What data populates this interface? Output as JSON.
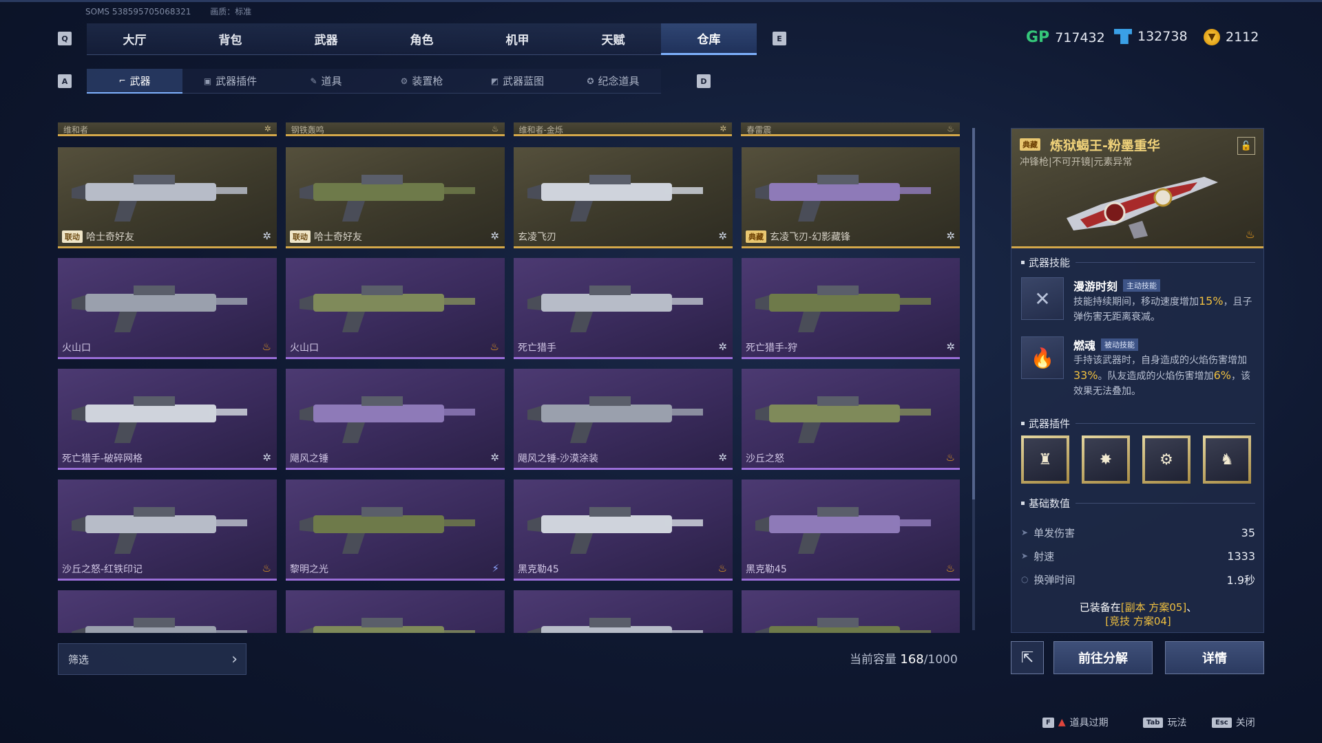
{
  "meta": {
    "server": "SOMS 538595705068321",
    "quality": "画质：标准"
  },
  "keys": {
    "prev_main": "Q",
    "next_main": "E",
    "prev_sub": "A",
    "next_sub": "D"
  },
  "main_tabs": [
    "大厅",
    "背包",
    "武器",
    "角色",
    "机甲",
    "天赋",
    "仓库"
  ],
  "main_active": "仓库",
  "currency": {
    "gp_label": "GP",
    "gp": "717432",
    "ticket": "132738",
    "coin": "2112"
  },
  "sub_tabs": [
    {
      "label": "武器",
      "icon": "gun-icon"
    },
    {
      "label": "武器插件",
      "icon": "chip-icon"
    },
    {
      "label": "道具",
      "icon": "item-icon"
    },
    {
      "label": "装置枪",
      "icon": "device-icon"
    },
    {
      "label": "武器蓝图",
      "icon": "blueprint-icon"
    },
    {
      "label": "纪念道具",
      "icon": "medal-icon"
    }
  ],
  "partial_row": [
    "维和者",
    "钢铁轰鸣",
    "维和者-金烁",
    "春雷震"
  ],
  "items": [
    {
      "name": "哈士奇好友",
      "tag": "联动",
      "rarity": "gold",
      "element": "frost"
    },
    {
      "name": "哈士奇好友",
      "tag": "联动",
      "rarity": "gold",
      "element": "frost"
    },
    {
      "name": "玄凌飞刃",
      "tag": "",
      "rarity": "gold",
      "element": "frost"
    },
    {
      "name": "玄凌飞刃-幻影藏锋",
      "tag": "典藏",
      "rarity": "gold",
      "element": "frost"
    },
    {
      "name": "火山口",
      "tag": "",
      "rarity": "purple",
      "element": "fire"
    },
    {
      "name": "火山口",
      "tag": "",
      "rarity": "purple",
      "element": "fire"
    },
    {
      "name": "死亡猎手",
      "tag": "",
      "rarity": "purple",
      "element": "frost"
    },
    {
      "name": "死亡猎手-狩",
      "tag": "",
      "rarity": "purple",
      "element": "frost"
    },
    {
      "name": "死亡猎手-破碎网格",
      "tag": "",
      "rarity": "purple",
      "element": "frost"
    },
    {
      "name": "飓风之锤",
      "tag": "",
      "rarity": "purple",
      "element": "frost"
    },
    {
      "name": "飓风之锤-沙漠涂装",
      "tag": "",
      "rarity": "purple",
      "element": "frost"
    },
    {
      "name": "沙丘之怒",
      "tag": "",
      "rarity": "purple",
      "element": "fire"
    },
    {
      "name": "沙丘之怒-红铁印记",
      "tag": "",
      "rarity": "purple",
      "element": "fire"
    },
    {
      "name": "黎明之光",
      "tag": "",
      "rarity": "purple",
      "element": "bolt"
    },
    {
      "name": "黑克勒45",
      "tag": "",
      "rarity": "purple",
      "element": "fire"
    },
    {
      "name": "黑克勒45",
      "tag": "",
      "rarity": "purple",
      "element": "fire"
    },
    {
      "name": "",
      "tag": "",
      "rarity": "purple",
      "element": ""
    },
    {
      "name": "",
      "tag": "",
      "rarity": "purple",
      "element": ""
    },
    {
      "name": "",
      "tag": "",
      "rarity": "purple",
      "element": ""
    },
    {
      "name": "",
      "tag": "",
      "rarity": "purple",
      "element": ""
    }
  ],
  "filter_label": "筛选",
  "capacity": {
    "label": "当前容量",
    "used": "168",
    "sep": "/",
    "total": "1000"
  },
  "detail": {
    "tag": "典藏",
    "title": "炼狱蝎王-粉墨重华",
    "subtitle": "冲锋枪|不可开镜|元素异常",
    "skills_title": "武器技能",
    "skill1": {
      "name": "漫游时刻",
      "type": "主动技能",
      "desc_a": "技能持续期间，移动速度增加",
      "hl": "15%",
      "desc_b": "，且子弹伤害无距离衰减。"
    },
    "skill2": {
      "name": "燃魂",
      "type": "被动技能",
      "desc_a": "手持该武器时，自身造成的火焰伤害增加",
      "hl1": "33%",
      "desc_b": "。队友造成的火焰伤害增加",
      "hl2": "6%",
      "desc_c": "，该效果无法叠加。"
    },
    "plugins_title": "武器插件",
    "stats_title": "基础数值",
    "stats": [
      {
        "label": "单发伤害",
        "value": "35"
      },
      {
        "label": "射速",
        "value": "1333"
      },
      {
        "label": "换弹时间",
        "value": "1.9秒"
      }
    ],
    "equipped_a": "已装备在",
    "equipped_b": "[副本 方案05]",
    "equipped_c": "、",
    "equipped_d": "[竞技 方案04]"
  },
  "buttons": {
    "decompose": "前往分解",
    "details": "详情"
  },
  "footer": [
    {
      "key": "F",
      "label": "道具过期"
    },
    {
      "key": "Tab",
      "label": "玩法"
    },
    {
      "key": "Esc",
      "label": "关闭"
    }
  ],
  "colors": {
    "gold": "#d4a84a",
    "purple": "#9a6ed8",
    "accent": "#7fb2ff",
    "highlight": "#f0c040"
  }
}
